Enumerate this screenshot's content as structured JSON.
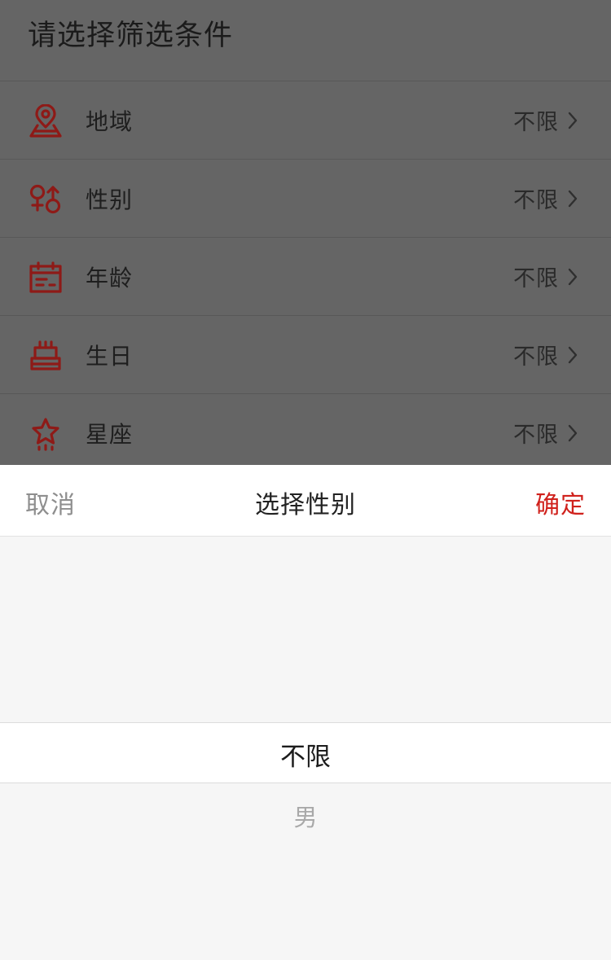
{
  "header": {
    "title": "请选择筛选条件"
  },
  "filters": [
    {
      "icon": "location-pin-icon",
      "label": "地域",
      "value": "不限"
    },
    {
      "icon": "gender-icon",
      "label": "性别",
      "value": "不限"
    },
    {
      "icon": "calendar-icon",
      "label": "年龄",
      "value": "不限"
    },
    {
      "icon": "birthday-cake-icon",
      "label": "生日",
      "value": "不限"
    },
    {
      "icon": "star-icon",
      "label": "星座",
      "value": "不限"
    }
  ],
  "sheet": {
    "cancel_label": "取消",
    "title": "选择性别",
    "confirm_label": "确定",
    "options": [
      "不限",
      "男"
    ],
    "selected": "不限"
  },
  "colors": {
    "accent": "#d0211c",
    "icon": "#8e1a17",
    "overlay": "#656565",
    "sheet_bg": "#f6f6f6"
  }
}
